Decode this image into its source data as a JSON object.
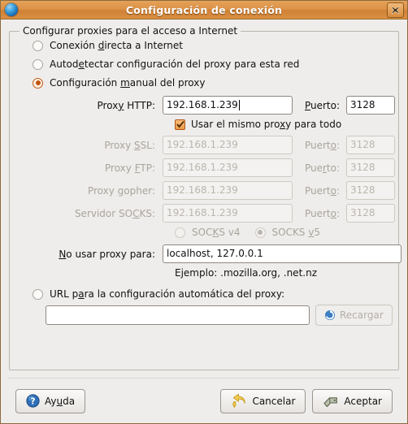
{
  "window": {
    "title": "Configuración de conexión",
    "icon": "globe-icon",
    "close_label": "×",
    "accent_titlebar": "#d98f44",
    "accent_selection": "#c2540c"
  },
  "groupbox": {
    "legend": "Configurar proxies para el acceso a Internet"
  },
  "proxy_mode": {
    "options": [
      {
        "label": "Conexión directa a Internet",
        "selected": false
      },
      {
        "label": "Autodetectar configuración del proxy para esta red",
        "selected": false
      },
      {
        "label": "Configuración manual del proxy",
        "selected": true
      }
    ]
  },
  "manual": {
    "http": {
      "label": "Proxy HTTP:",
      "value": "192.168.1.239",
      "port_label": "Puerto:",
      "port_value": "3128",
      "enabled": true,
      "focused": true
    },
    "same_proxy": {
      "label": "Usar el mismo proxy para todo",
      "checked": true
    },
    "ssl": {
      "label": "Proxy SSL:",
      "value": "192.168.1.239",
      "port_label": "Puerto:",
      "port_value": "3128",
      "enabled": false
    },
    "ftp": {
      "label": "Proxy FTP:",
      "value": "192.168.1.239",
      "port_label": "Puerto:",
      "port_value": "3128",
      "enabled": false
    },
    "gopher": {
      "label": "Proxy gopher:",
      "value": "192.168.1.239",
      "port_label": "Puerto:",
      "port_value": "3128",
      "enabled": false
    },
    "socks": {
      "label": "Servidor SOCKS:",
      "value": "192.168.1.239",
      "port_label": "Puerto:",
      "port_value": "3128",
      "enabled": false
    },
    "socks_version": {
      "v4_label": "SOCKS v4",
      "v5_label": "SOCKS v5",
      "selected": "v5",
      "enabled": false
    }
  },
  "no_proxy": {
    "label": "No usar proxy para:",
    "value": "localhost, 127.0.0.1",
    "example": "Ejemplo: .mozilla.org, .net.nz"
  },
  "auto_url": {
    "radio_label": "URL para la configuración automática del proxy:",
    "selected": false,
    "value": "",
    "reload_label": "Recargar",
    "reload_icon": "refresh-icon",
    "reload_enabled": false
  },
  "actions": {
    "help_label": "Ayuda",
    "help_icon": "help-icon",
    "cancel_label": "Cancelar",
    "cancel_icon": "undo-arrow-icon",
    "accept_label": "Aceptar",
    "accept_icon": "apply-tag-icon"
  }
}
